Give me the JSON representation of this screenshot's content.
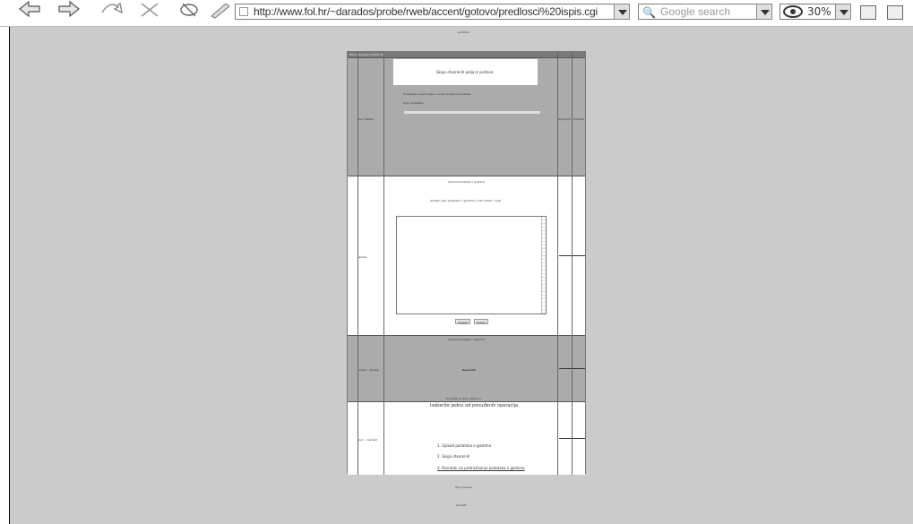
{
  "browser": {
    "url": "http://www.fol.hr/~darados/probe/rweb/accent/gotovo/predlosci%20ispis.cgi",
    "search_placeholder": "Google search",
    "zoom_level": "30%"
  },
  "page": {
    "top_title": "predlošci",
    "header_row": "ddd sedd_tedrd idddd ed",
    "footer_1": "Opis sustava",
    "footer_2": "Kontakt"
  },
  "rows": [
    {
      "side_label": "izvor teksta",
      "title": "Skupi otvorenih polja iz sustava",
      "desc": "Dodavanje svojih polja u sustav prijenos podataka",
      "field_label": "Izvor podataka:",
      "col3": "ispunjeno",
      "col4": "Provjera"
    },
    {
      "side_label": "upload",
      "title": "Upload podataka o gostima",
      "desc": "Ukratko opis podataka o gostima u CSV obliku i opisi",
      "btn1": "Pregled",
      "btn2": "Pošalji"
    },
    {
      "side_label": "upload - obrada",
      "title": "Upload podataka o gostima",
      "mid_label": "Započeti",
      "bottom_label": "Povratak na prvu stranicu"
    },
    {
      "side_label": "izvor - završeti",
      "title": "Izaberite jednu od ponuđenih operacija",
      "items": [
        "1. Upload podataka o gostima",
        "2. Skupi otvorenih",
        "3. Povratak na pretraživanje podataka o gostima"
      ]
    }
  ]
}
